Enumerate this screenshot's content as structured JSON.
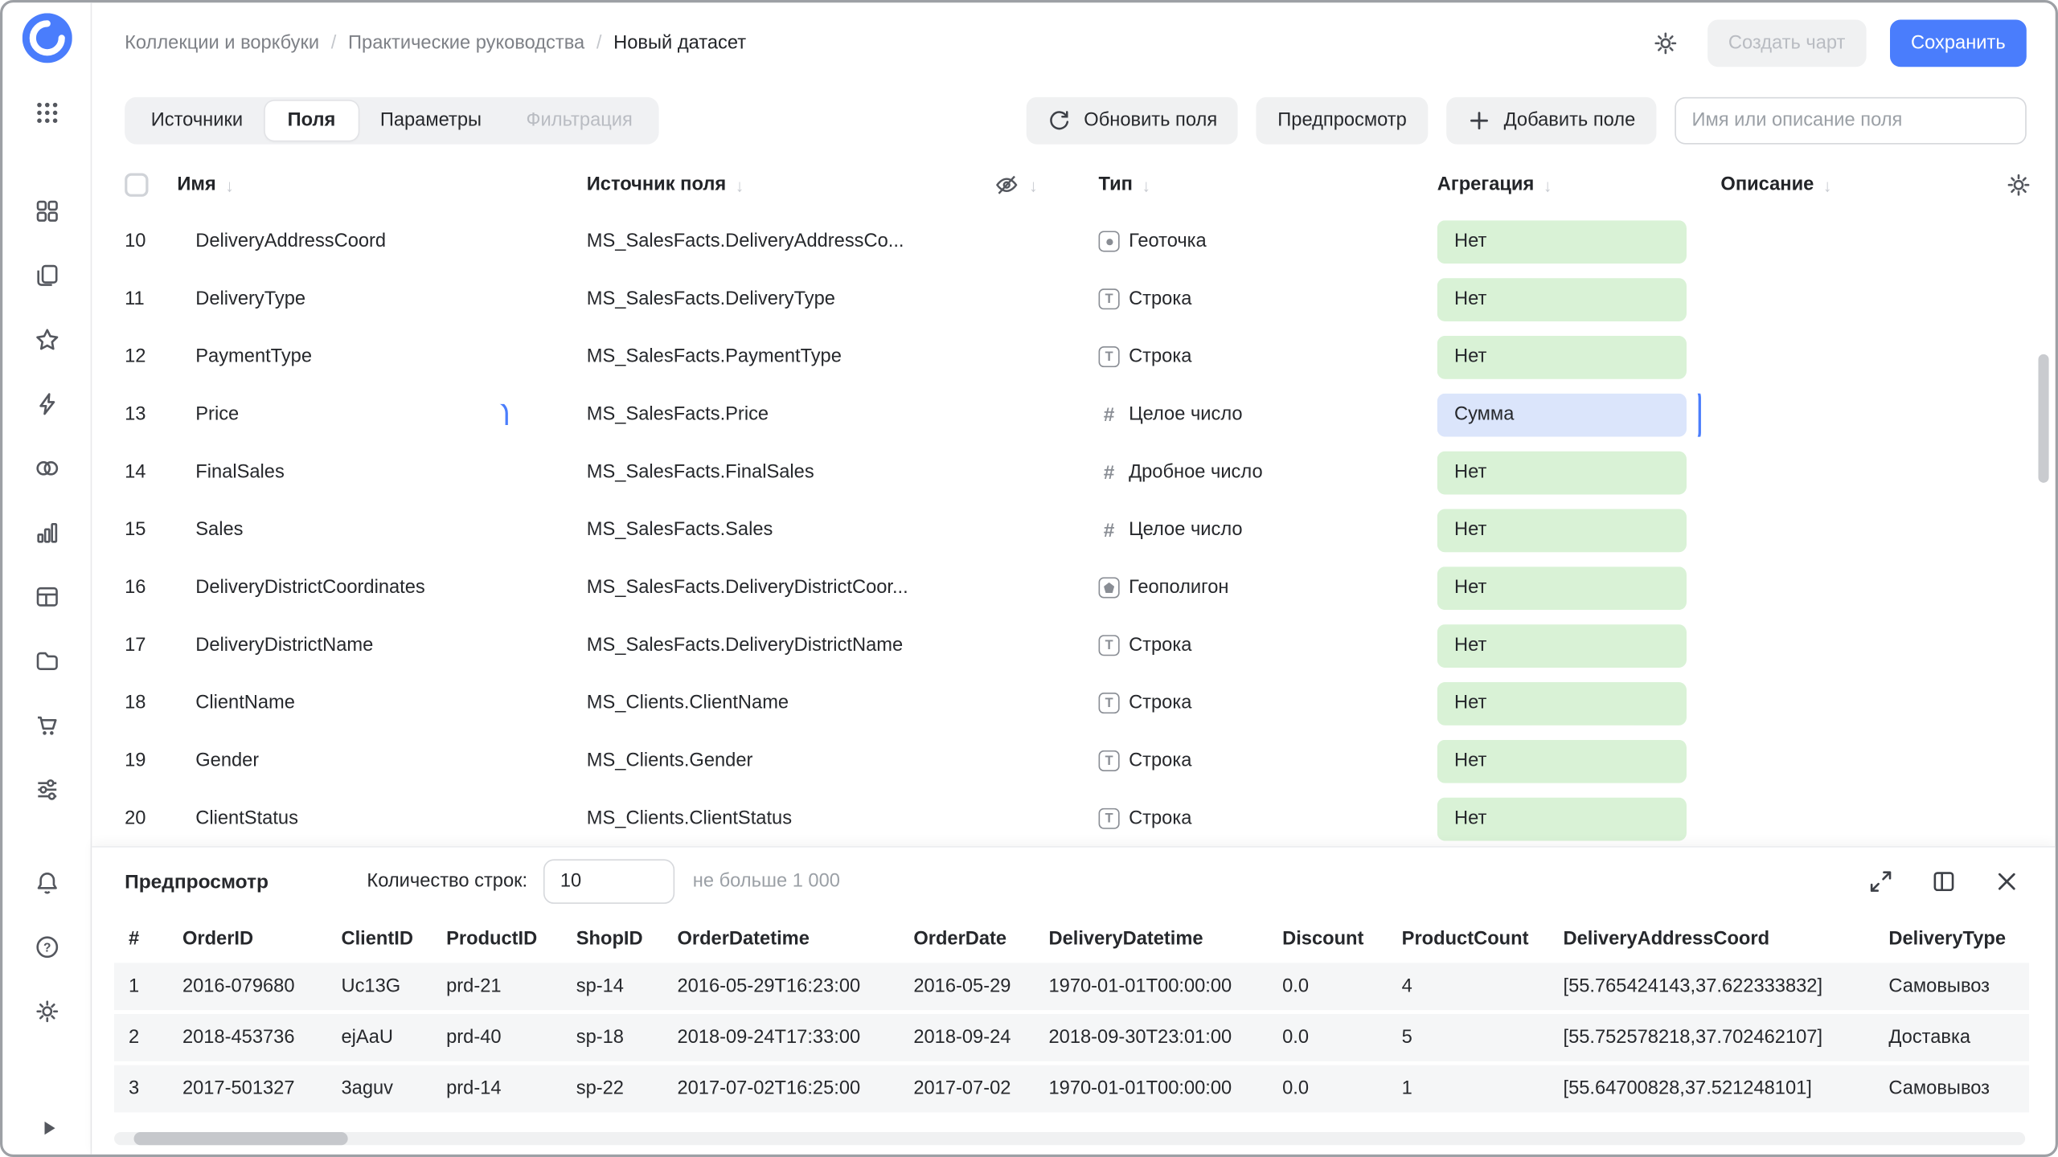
{
  "header": {
    "breadcrumb": [
      "Коллекции и воркбуки",
      "Практические руководства",
      "Новый датасет"
    ],
    "actions": {
      "create_chart": "Создать чарт",
      "save": "Сохранить"
    }
  },
  "tabs": {
    "items": [
      {
        "label": "Источники",
        "state": "default"
      },
      {
        "label": "Поля",
        "state": "active"
      },
      {
        "label": "Параметры",
        "state": "default"
      },
      {
        "label": "Фильтрация",
        "state": "disabled"
      }
    ]
  },
  "toolbar": {
    "refresh_fields": "Обновить поля",
    "preview": "Предпросмотр",
    "add_field": "Добавить поле",
    "search_placeholder": "Имя или описание поля"
  },
  "fields_table": {
    "columns": [
      "Имя",
      "Источник поля",
      "Тип",
      "Агрегация",
      "Описание"
    ],
    "rows": [
      {
        "num": "10",
        "name": "DeliveryAddressCoord",
        "source": "MS_SalesFacts.DeliveryAddressCo...",
        "type": "Геоточка",
        "type_icon": "geopoint",
        "agg": "Нет"
      },
      {
        "num": "11",
        "name": "DeliveryType",
        "source": "MS_SalesFacts.DeliveryType",
        "type": "Строка",
        "type_icon": "string",
        "agg": "Нет"
      },
      {
        "num": "12",
        "name": "PaymentType",
        "source": "MS_SalesFacts.PaymentType",
        "type": "Строка",
        "type_icon": "string",
        "agg": "Нет"
      },
      {
        "num": "13",
        "name": "Price",
        "source": "MS_SalesFacts.Price",
        "type": "Целое число",
        "type_icon": "integer",
        "agg": "Сумма",
        "selected": true
      },
      {
        "num": "14",
        "name": "FinalSales",
        "source": "MS_SalesFacts.FinalSales",
        "type": "Дробное число",
        "type_icon": "float",
        "agg": "Нет"
      },
      {
        "num": "15",
        "name": "Sales",
        "source": "MS_SalesFacts.Sales",
        "type": "Целое число",
        "type_icon": "integer",
        "agg": "Нет"
      },
      {
        "num": "16",
        "name": "DeliveryDistrictCoordinates",
        "source": "MS_SalesFacts.DeliveryDistrictCoor...",
        "type": "Геополигон",
        "type_icon": "geopolygon",
        "agg": "Нет"
      },
      {
        "num": "17",
        "name": "DeliveryDistrictName",
        "source": "MS_SalesFacts.DeliveryDistrictName",
        "type": "Строка",
        "type_icon": "string",
        "agg": "Нет"
      },
      {
        "num": "18",
        "name": "ClientName",
        "source": "MS_Clients.ClientName",
        "type": "Строка",
        "type_icon": "string",
        "agg": "Нет"
      },
      {
        "num": "19",
        "name": "Gender",
        "source": "MS_Clients.Gender",
        "type": "Строка",
        "type_icon": "string",
        "agg": "Нет"
      },
      {
        "num": "20",
        "name": "ClientStatus",
        "source": "MS_Clients.ClientStatus",
        "type": "Строка",
        "type_icon": "string",
        "agg": "Нет"
      }
    ]
  },
  "preview": {
    "title": "Предпросмотр",
    "rows_label": "Количество строк:",
    "rows_value": "10",
    "rows_hint": "не больше 1 000",
    "columns": [
      "#",
      "OrderID",
      "ClientID",
      "ProductID",
      "ShopID",
      "OrderDatetime",
      "OrderDate",
      "DeliveryDatetime",
      "Discount",
      "ProductCount",
      "DeliveryAddressCoord",
      "DeliveryType"
    ],
    "rows": [
      [
        "1",
        "2016-079680",
        "Uc13G",
        "prd-21",
        "sp-14",
        "2016-05-29T16:23:00",
        "2016-05-29",
        "1970-01-01T00:00:00",
        "0.0",
        "4",
        "[55.765424143,37.622333832]",
        "Самовывоз"
      ],
      [
        "2",
        "2018-453736",
        "ejAaU",
        "prd-40",
        "sp-18",
        "2018-09-24T17:33:00",
        "2018-09-24",
        "2018-09-30T23:01:00",
        "0.0",
        "5",
        "[55.752578218,37.702462107]",
        "Доставка"
      ],
      [
        "3",
        "2017-501327",
        "3aguv",
        "prd-14",
        "sp-22",
        "2017-07-02T16:25:00",
        "2017-07-02",
        "1970-01-01T00:00:00",
        "0.0",
        "1",
        "[55.64700828,37.521248101]",
        "Самовывоз"
      ]
    ]
  },
  "icons": {
    "sort_arrow": "↓",
    "hash_glyph": "#",
    "sidebar": [
      "apps-grid",
      "dashboards",
      "workbooks",
      "favorites",
      "functions",
      "connections",
      "charts",
      "datasets",
      "files",
      "marketplace",
      "services"
    ],
    "sidebar_bottom": [
      "bell",
      "help",
      "gear"
    ],
    "header": [
      "gear"
    ],
    "preview_controls": [
      "expand",
      "panel",
      "close"
    ]
  },
  "colors": {
    "accent": "#4a7dfc",
    "selection_border": "#4a7dfc",
    "pill_green_bg": "#d9f2d6",
    "pill_blue_bg": "#dbe5fb"
  }
}
